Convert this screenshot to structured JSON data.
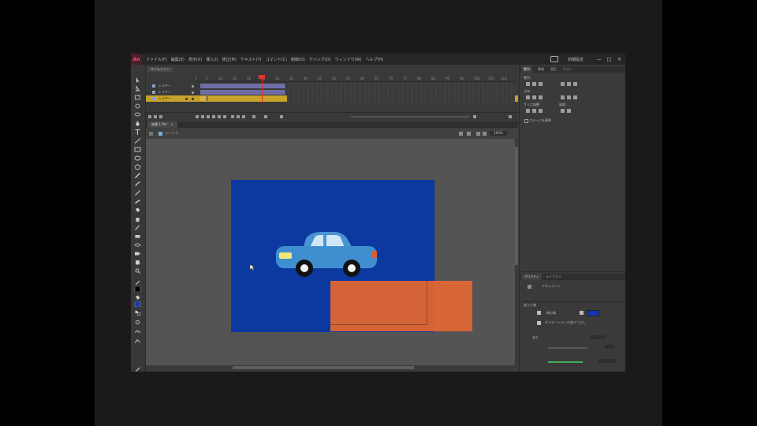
{
  "app": {
    "logo": "An",
    "menu": [
      "ファイル(F)",
      "編集(E)",
      "表示(V)",
      "挿入(I)",
      "修正(M)",
      "テキスト(T)",
      "コマンド(C)",
      "制御(O)",
      "デバッグ(D)",
      "ウィンドウ(W)",
      "ヘルプ(H)"
    ],
    "workspace": "初期設定",
    "window_controls": [
      "—",
      "□",
      "×"
    ]
  },
  "timeline": {
    "tab_label": "タイムライン",
    "frame_numbers": [
      "1",
      "5",
      "10",
      "15",
      "20",
      "25",
      "30",
      "35",
      "40",
      "45",
      "50",
      "55",
      "60",
      "65",
      "70",
      "75",
      "80",
      "85",
      "90",
      "95",
      "100",
      "105",
      "110",
      "115"
    ],
    "layers": [
      {
        "name": "レイヤー",
        "selected": false
      },
      {
        "name": "レイヤー",
        "selected": false
      },
      {
        "name": "レイヤー",
        "selected": true
      }
    ]
  },
  "document": {
    "tab_label": "無題-1.fla*",
    "tab_close": "×",
    "scene_label": "シーン 1",
    "zoom": "100%"
  },
  "stage": {
    "background_color": "#0c39a0",
    "rect_color": "#dd6634",
    "car_color": "#3f8fd0"
  },
  "properties": {
    "tabs": [
      "プロパティ",
      "ライブラリ"
    ],
    "type_label": "ドキュメント",
    "fill_stroke_header": "塗りと線",
    "brush_label": "線の幅",
    "fill_label": "塗り",
    "gradient_text": "グラデーションの塗りつぶし"
  },
  "align": {
    "tabs": [
      "整列",
      "情報",
      "変形",
      "カラー"
    ],
    "align_label": "整列:",
    "distribute_label": "分布:",
    "match_size_label": "サイズ調整:",
    "space_label": "間隔:",
    "to_stage_label": "ステージを基準"
  }
}
